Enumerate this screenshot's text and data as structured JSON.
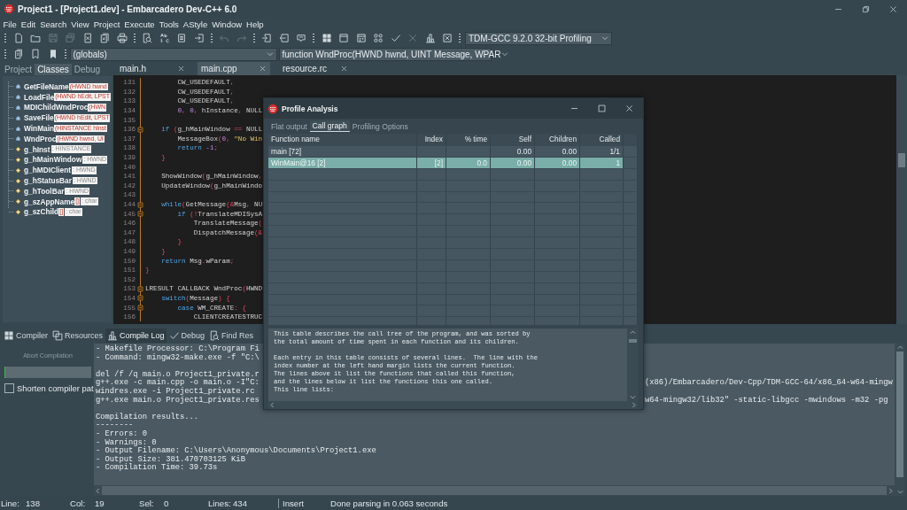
{
  "window": {
    "title": "Project1 - [Project1.dev] - Embarcadero Dev-C++ 6.0"
  },
  "menu": [
    "File",
    "Edit",
    "Search",
    "View",
    "Project",
    "Execute",
    "Tools",
    "AStyle",
    "Window",
    "Help"
  ],
  "toolbar": {
    "buttons": [
      {
        "disabled": false
      },
      {
        "disabled": false
      },
      {
        "disabled": true
      },
      {
        "disabled": true
      },
      {
        "disabled": false
      },
      {
        "disabled": false
      },
      {
        "disabled": false
      },
      {
        "disabled": false
      },
      {
        "disabled": false
      },
      {
        "disabled": false
      },
      {
        "disabled": false
      },
      {
        "disabled": true
      },
      {
        "disabled": true
      },
      {
        "disabled": false
      },
      {
        "disabled": false
      },
      {
        "disabled": false
      },
      {
        "disabled": false
      },
      {
        "disabled": false
      },
      {
        "disabled": false
      },
      {
        "disabled": false
      },
      {
        "disabled": false
      },
      {
        "disabled": true
      },
      {
        "disabled": false
      },
      {
        "disabled": false
      }
    ],
    "compiler": "TDM-GCC 9.2.0 32-bit Profiling"
  },
  "toolbar2": {
    "buttons": [
      {
        "disabled": false
      },
      {
        "disabled": false
      },
      {
        "disabled": false
      }
    ],
    "scope": "(globals)",
    "function": "function WndProc(HWND hwnd, UINT Message, WPAR"
  },
  "sidebar": {
    "tabs": [
      {
        "label": "Project",
        "selected": false
      },
      {
        "label": "Classes",
        "selected": true
      },
      {
        "label": "Debug",
        "selected": false
      }
    ],
    "items": [
      {
        "kind": "function",
        "name": "GetFileName",
        "signature": "(HWND hwnd"
      },
      {
        "kind": "function",
        "name": "LoadFile",
        "signature": "(HWND hEdit, LPST"
      },
      {
        "kind": "function",
        "name": "MDIChildWndProc",
        "signature": "(HWN"
      },
      {
        "kind": "function",
        "name": "SaveFile",
        "signature": "(HWND hEdit, LPST"
      },
      {
        "kind": "function",
        "name": "WinMain",
        "signature": "(HINSTANCE hInst"
      },
      {
        "kind": "function",
        "name": "WndProc",
        "signature": "(HWND hwnd, UI"
      },
      {
        "kind": "variable",
        "name": "g_hInst",
        "type": ": HINSTANCE"
      },
      {
        "kind": "variable",
        "name": "g_hMainWindow",
        "type": ": HWND"
      },
      {
        "kind": "variable",
        "name": "g_hMDIClient",
        "type": ": HWND"
      },
      {
        "kind": "variable",
        "name": "g_hStatusBar",
        "type": ": HWND"
      },
      {
        "kind": "variable",
        "name": "g_hToolBar",
        "type": ": HWND"
      },
      {
        "kind": "variable",
        "name": "g_szAppName",
        "array": "[]",
        "type": ": char"
      },
      {
        "kind": "variable",
        "name": "g_szChild",
        "array": "[]",
        "type": ": char"
      }
    ]
  },
  "editor": {
    "tabs": [
      {
        "label": "main.h",
        "selected": false
      },
      {
        "label": "main.cpp",
        "selected": true
      },
      {
        "label": "resource.rc",
        "selected": false
      }
    ],
    "lines": [
      {
        "number": "131",
        "fold": false,
        "tokens": [
          {
            "kind": "id",
            "text": "        CW_USEDEFAULT"
          },
          {
            "kind": "op",
            "text": ","
          }
        ]
      },
      {
        "number": "132",
        "fold": false,
        "tokens": [
          {
            "kind": "id",
            "text": "        CW_USEDEFAULT"
          },
          {
            "kind": "op",
            "text": ","
          }
        ]
      },
      {
        "number": "133",
        "fold": false,
        "tokens": [
          {
            "kind": "id",
            "text": "        CW_USEDEFAULT"
          },
          {
            "kind": "op",
            "text": ","
          }
        ]
      },
      {
        "number": "134",
        "fold": false,
        "tokens": [
          {
            "kind": "num",
            "text": "        0"
          },
          {
            "kind": "op",
            "text": ", "
          },
          {
            "kind": "num",
            "text": "0"
          },
          {
            "kind": "op",
            "text": ", "
          },
          {
            "kind": "id",
            "text": "hInstance"
          },
          {
            "kind": "op",
            "text": ", "
          },
          {
            "kind": "id",
            "text": "NULL"
          }
        ]
      },
      {
        "number": "135",
        "fold": false
      },
      {
        "number": "136",
        "fold": true,
        "tokens": [
          {
            "kind": "kw",
            "text": "    if "
          },
          {
            "kind": "op",
            "text": "("
          },
          {
            "kind": "id",
            "text": "g_hMainWindow "
          },
          {
            "kind": "op",
            "text": "=="
          },
          {
            "kind": "id",
            "text": " NULL"
          }
        ]
      },
      {
        "number": "137",
        "fold": false,
        "tokens": [
          {
            "kind": "id",
            "text": "        MessageBox"
          },
          {
            "kind": "op",
            "text": "("
          },
          {
            "kind": "num",
            "text": "0"
          },
          {
            "kind": "op",
            "text": ", "
          },
          {
            "kind": "str",
            "text": "\"No Win"
          }
        ]
      },
      {
        "number": "138",
        "fold": false,
        "tokens": [
          {
            "kind": "kw",
            "text": "        return "
          },
          {
            "kind": "num",
            "text": "-1"
          },
          {
            "kind": "op",
            "text": ";"
          }
        ]
      },
      {
        "number": "139",
        "fold": false,
        "tokens": [
          {
            "kind": "op",
            "text": "    }"
          }
        ]
      },
      {
        "number": "140",
        "fold": false
      },
      {
        "number": "141",
        "fold": false,
        "tokens": [
          {
            "kind": "id",
            "text": "    ShowWindow"
          },
          {
            "kind": "op",
            "text": "("
          },
          {
            "kind": "id",
            "text": "g_hMainWindow"
          },
          {
            "kind": "op",
            "text": ","
          }
        ]
      },
      {
        "number": "142",
        "fold": false,
        "tokens": [
          {
            "kind": "id",
            "text": "    UpdateWindow"
          },
          {
            "kind": "op",
            "text": "("
          },
          {
            "kind": "id",
            "text": "g_hMainWindo"
          }
        ]
      },
      {
        "number": "143",
        "fold": false
      },
      {
        "number": "144",
        "fold": true,
        "tokens": [
          {
            "kind": "kw",
            "text": "    while"
          },
          {
            "kind": "op",
            "text": "("
          },
          {
            "kind": "id",
            "text": "GetMessage"
          },
          {
            "kind": "op",
            "text": "(&"
          },
          {
            "kind": "id",
            "text": "Msg"
          },
          {
            "kind": "op",
            "text": ", "
          },
          {
            "kind": "id",
            "text": "NU"
          }
        ]
      },
      {
        "number": "145",
        "fold": true,
        "tokens": [
          {
            "kind": "kw",
            "text": "        if "
          },
          {
            "kind": "op",
            "text": "(!"
          },
          {
            "kind": "id",
            "text": "TranslateMDISysA"
          }
        ]
      },
      {
        "number": "146",
        "fold": false,
        "tokens": [
          {
            "kind": "id",
            "text": "            TranslateMessage"
          },
          {
            "kind": "op",
            "text": "("
          }
        ]
      },
      {
        "number": "147",
        "fold": false,
        "tokens": [
          {
            "kind": "id",
            "text": "            DispatchMessage"
          },
          {
            "kind": "op",
            "text": "(&"
          }
        ]
      },
      {
        "number": "148",
        "fold": false,
        "tokens": [
          {
            "kind": "op",
            "text": "        }"
          }
        ]
      },
      {
        "number": "149",
        "fold": false,
        "tokens": [
          {
            "kind": "op",
            "text": "    }"
          }
        ]
      },
      {
        "number": "150",
        "fold": false,
        "tokens": [
          {
            "kind": "kw",
            "text": "    return "
          },
          {
            "kind": "id",
            "text": "Msg"
          },
          {
            "kind": "op",
            "text": "."
          },
          {
            "kind": "id",
            "text": "wParam"
          },
          {
            "kind": "op",
            "text": ";"
          }
        ]
      },
      {
        "number": "151",
        "fold": false,
        "tokens": [
          {
            "kind": "op",
            "text": "}"
          }
        ]
      },
      {
        "number": "152",
        "fold": false
      },
      {
        "number": "153",
        "fold": true,
        "tokens": [
          {
            "kind": "id",
            "text": "LRESULT CALLBACK WndProc"
          },
          {
            "kind": "op",
            "text": "("
          },
          {
            "kind": "id",
            "text": "HWND"
          }
        ]
      },
      {
        "number": "154",
        "fold": true,
        "tokens": [
          {
            "kind": "kw",
            "text": "    switch"
          },
          {
            "kind": "op",
            "text": "("
          },
          {
            "kind": "id",
            "text": "Message"
          },
          {
            "kind": "op",
            "text": ") {"
          }
        ]
      },
      {
        "number": "155",
        "fold": true,
        "tokens": [
          {
            "kind": "kw",
            "text": "        case "
          },
          {
            "kind": "id",
            "text": "WM_CREATE"
          },
          {
            "kind": "op",
            "text": ": {"
          }
        ]
      },
      {
        "number": "156",
        "fold": false,
        "tokens": [
          {
            "kind": "id",
            "text": "            CLIENTCREATESTRUC"
          }
        ]
      }
    ]
  },
  "bottom_panel": {
    "tabs": [
      {
        "label": "Compiler",
        "selected": false
      },
      {
        "label": "Resources",
        "selected": false
      },
      {
        "label": "Compile Log",
        "selected": true
      },
      {
        "label": "Debug",
        "selected": false
      },
      {
        "label": "Find Res",
        "selected": false
      }
    ],
    "abort_button": {
      "label": "Abort Compilation",
      "disabled": true
    },
    "progress": {
      "level": 0
    },
    "shorten_checkbox": {
      "label": "Shorten compiler pat",
      "checked": false
    },
    "log": [
      {
        "kind": "line",
        "text": "- Makefile Processor: C:\\Program Fi"
      },
      {
        "kind": "line",
        "text": "- Command: mingw32-make.exe -f \"C:\\"
      },
      {
        "kind": "blank"
      },
      {
        "kind": "line",
        "text": "del /f /q main.o Project1_private.r"
      },
      {
        "kind": "line",
        "text": "g++.exe -c main.cpp -o main.o -I\"C:",
        "tail": "(x86)/Embarcadero/Dev-Cpp/TDM-GCC-64/x86_64-w64-mingw"
      },
      {
        "kind": "line",
        "text": "windres.exe -i Project1_private.rc"
      },
      {
        "kind": "line",
        "text": "g++.exe main.o Project1_private.res",
        "tail": "w64-mingw32/lib32\" -static-libgcc -mwindows -m32 -pg"
      },
      {
        "kind": "blank"
      },
      {
        "kind": "line",
        "text": "Compilation results..."
      },
      {
        "kind": "line",
        "text": "--------"
      },
      {
        "kind": "line",
        "text": "- Errors: 0"
      },
      {
        "kind": "line",
        "text": "- Warnings: 0"
      },
      {
        "kind": "line",
        "text": "- Output Filename: C:\\Users\\Anonymous\\Documents\\Project1.exe"
      },
      {
        "kind": "line",
        "text": "- Output Size: 381.470703125 KiB"
      },
      {
        "kind": "line",
        "text": "- Compilation Time: 39.73s"
      }
    ]
  },
  "status_bar": {
    "fields": [
      {
        "label": "Line:",
        "value": "138"
      },
      {
        "label": "Col:",
        "value": "19"
      },
      {
        "label": "Sel:",
        "value": "0"
      },
      {
        "label": "Lines:",
        "value": "434"
      }
    ],
    "mode": "Insert",
    "message": "Done parsing in 0.063 seconds"
  },
  "dialog": {
    "title": "Profile Analysis",
    "tabs": [
      {
        "label": "Flat output",
        "selected": false
      },
      {
        "label": "Call graph",
        "selected": true
      },
      {
        "label": "Profiling Options",
        "selected": false
      }
    ],
    "columns": [
      "Function name",
      "Index",
      "% time",
      "Self",
      "Children",
      "Called"
    ],
    "rows": [
      {
        "function": "main [72]",
        "self": "0.00",
        "children": "0.00",
        "called": "1/1",
        "selected": false
      },
      {
        "function": "WinMain@16 [2]",
        "index": "[2]",
        "time": "0.0",
        "self": "0.00",
        "children": "0.00",
        "called": "1",
        "selected": true
      }
    ],
    "description": "This table describes the call tree of the program, and was sorted by\nthe total amount of time spent in each function and its children.\n\nEach entry in this table consists of several lines.  The line with the\nindex number at the left hand margin lists the current function.\nThe lines above it list the functions that called this function,\nand the lines below it list the functions this one called.\nThis line lists:"
  }
}
